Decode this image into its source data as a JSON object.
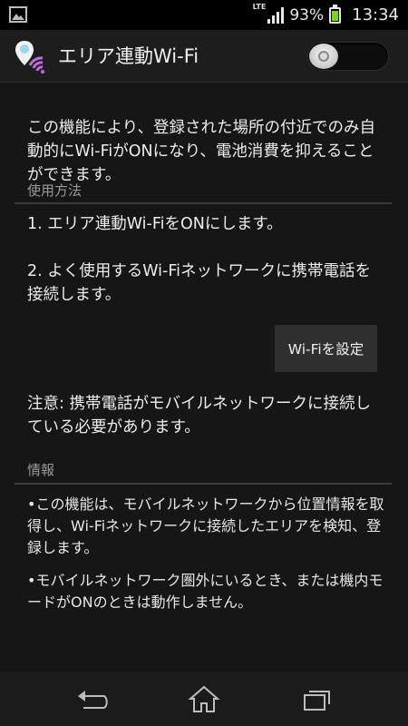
{
  "status_bar": {
    "network": "LTE",
    "battery_percent": "93%",
    "battery_level": 0.93,
    "time": "13:34",
    "accent_battery": "#7ed321"
  },
  "header": {
    "title": "エリア連動Wi-Fi",
    "icon": "wifi-location-icon",
    "toggle_state": "off"
  },
  "intro": "この機能により、登録された場所の付近でのみ自動的にWi-FiがONになり、電池消費を抑えることができます。",
  "usage": {
    "heading": "使用方法",
    "step1": "1. エリア連動Wi-FiをONにします。",
    "step2": "2. よく使用するWi-Fiネットワークに携帯電話を接続します。",
    "button_label": "Wi-Fiを設定",
    "note": "注意: 携帯電話がモバイルネットワークに接続している必要があります。"
  },
  "info": {
    "heading": "情報",
    "bullet1": "•この機能は、モバイルネットワークから位置情報を取得し、Wi-Fiネットワークに接続したエリアを検知、登録します。",
    "bullet2": "•モバイルネットワーク圏外にいるとき、または機内モードがONのときは動作しません。"
  },
  "nav": {
    "back": "back-icon",
    "home": "home-icon",
    "recents": "recent-apps-icon"
  }
}
